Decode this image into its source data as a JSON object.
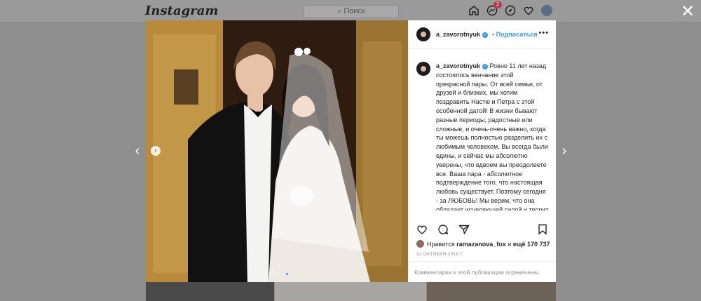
{
  "app": {
    "logo": "Instagram",
    "search_placeholder": "⌕ Поиск",
    "notification_count": "2"
  },
  "post": {
    "username": "a_zavorotnyuk",
    "follow_label": "• Подписаться",
    "more_label": "•••",
    "caption": "Ровно 11 лет назад состоялось венчание этой прекрасной пары. От всей семьи, от друзей и близких, мы хотим поздравить Настю и Петра с этой особенной датой! В жизни бывают разные периоды, радостные или сложные, и очень-очень важно, когда ты можешь полностью разделить их с любимым человеком. Вы всегда были едины, и сейчас мы абсолютно уверены, что вдвоем вы преодолеете все. Ваша пара - абсолютное подтверждение того, что настоящая любовь существует. Поэтому сегодня - за ЛЮБОВЬ! Мы верим, что она обладает исцеляющей силой и творит чудеса!",
    "caption_hearts": "❤️❤️❤️",
    "likes_prefix": "Нравится",
    "likes_user": "ramazanova_fox",
    "likes_middle": "и",
    "likes_count": "ещё 170 737",
    "date": "12 ОКТЯБРЯ 2019 Г.",
    "comments_disabled": "Комментарии к этой публикации ограничены.",
    "carousel": {
      "total": 6,
      "active_index": 5
    }
  },
  "icons": [
    "home-icon",
    "messenger-icon",
    "explore-icon",
    "heart-icon",
    "close-icon",
    "heart-outline-icon",
    "comment-icon",
    "share-icon",
    "bookmark-icon",
    "chevron-left-icon",
    "chevron-right-icon"
  ],
  "colors": {
    "link_blue": "#3897f0",
    "text": "#262626",
    "muted": "#8e8e8e",
    "overlay": "#8f8f8f"
  },
  "controls": {
    "close": "✕",
    "prev": "‹",
    "next": "›",
    "photo_prev": "‹"
  }
}
